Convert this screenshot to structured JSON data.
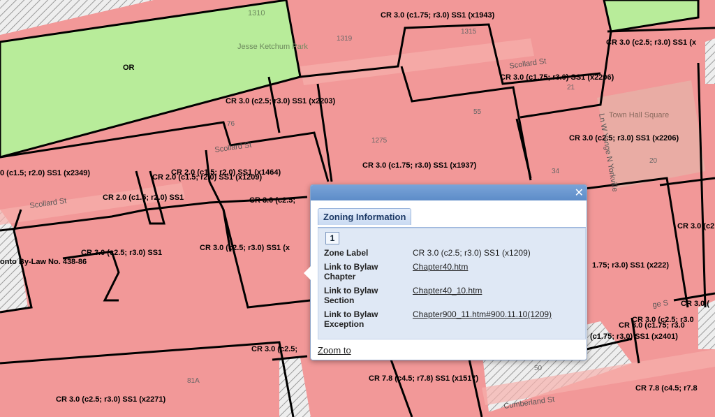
{
  "colors": {
    "zone_commercial": "#f29898",
    "zone_open_space": "#b8ec9a",
    "zone_hatched_bg": "#e8e8e8",
    "boundary": "#000000",
    "popup_header": "#5d8cc8"
  },
  "map": {
    "zone_labels": [
      "CR 3.0 (c1.75; r3.0) SS1  (x1943)",
      "CR 3.0 (c2.5; r3.0) SS1  (x",
      "CR 3.0 (c1.75; r3.0) SS1  (x2206)",
      "OR",
      "CR 3.0 (c2.5; r3.0) SS1  (x2203)",
      "CR 3.0 (c2.5; r3.0) SS1  (x2206)",
      "CR 3.0 (c1.75; r3.0) SS1  (x1937)",
      "0 (c1.5; r2.0) SS1  (x2349)",
      "CR 2.0 (c1.5; r2.0) SS1  (x1464)",
      "CR 2.0 (c1.5; r2.0) SS1  (x1209)",
      "CR 2.0 (c1.5; r2.0) SS1",
      "CR 3.0 (c2.5;",
      "CR 3.0 (c2.5;",
      "CR 3.0 (c2.5; r3.0) SS1",
      "CR 3.0 (c2.5; r3.0) SS1  (x",
      "onto By-Law No. 438-86",
      "1.75; r3.0) SS1  (x222)",
      "CR 3.0 (",
      "CR 3.0 (c2.5; r3.0",
      "CR 3.0 (c1.75; r3.0",
      "(c1.75; r3.0) SS1  (x2401)",
      "CR 3.0 (c2.5;",
      "CR 7.8 (c4.5; r7.8) SS1  (x1517)",
      "CR 7.8 (c4.5; r7.8",
      "CR 3.0 (c2.5; r3.0) SS1  (x2271)"
    ],
    "streets": [
      "Scollard St",
      "Scollard St",
      "Scollard St",
      "Cumberland St",
      "Ln W Yonge N Yorkville",
      "ge S"
    ],
    "places": [
      "Jesse Ketchum Park",
      "Town Hall Square"
    ],
    "park_numbers": [
      "1310"
    ],
    "building_numbers": [
      "1319",
      "1315",
      "21",
      "55",
      "1275",
      "34",
      "20",
      "76",
      "81A",
      "50"
    ]
  },
  "popup": {
    "close_label": "✕",
    "tab_label": "Zoning Information",
    "page": "1",
    "rows": [
      {
        "key": "Zone Label",
        "value": "CR 3.0 (c2.5; r3.0) SS1 (x1209)",
        "link": false
      },
      {
        "key": "Link to Bylaw Chapter",
        "value": "Chapter40.htm",
        "link": true
      },
      {
        "key": "Link to Bylaw Section",
        "value": "Chapter40_10.htm",
        "link": true
      },
      {
        "key": "Link to Bylaw Exception",
        "value": "Chapter900_11.htm#900.11.10(1209)",
        "link": true
      }
    ],
    "zoom_label": "Zoom to"
  }
}
